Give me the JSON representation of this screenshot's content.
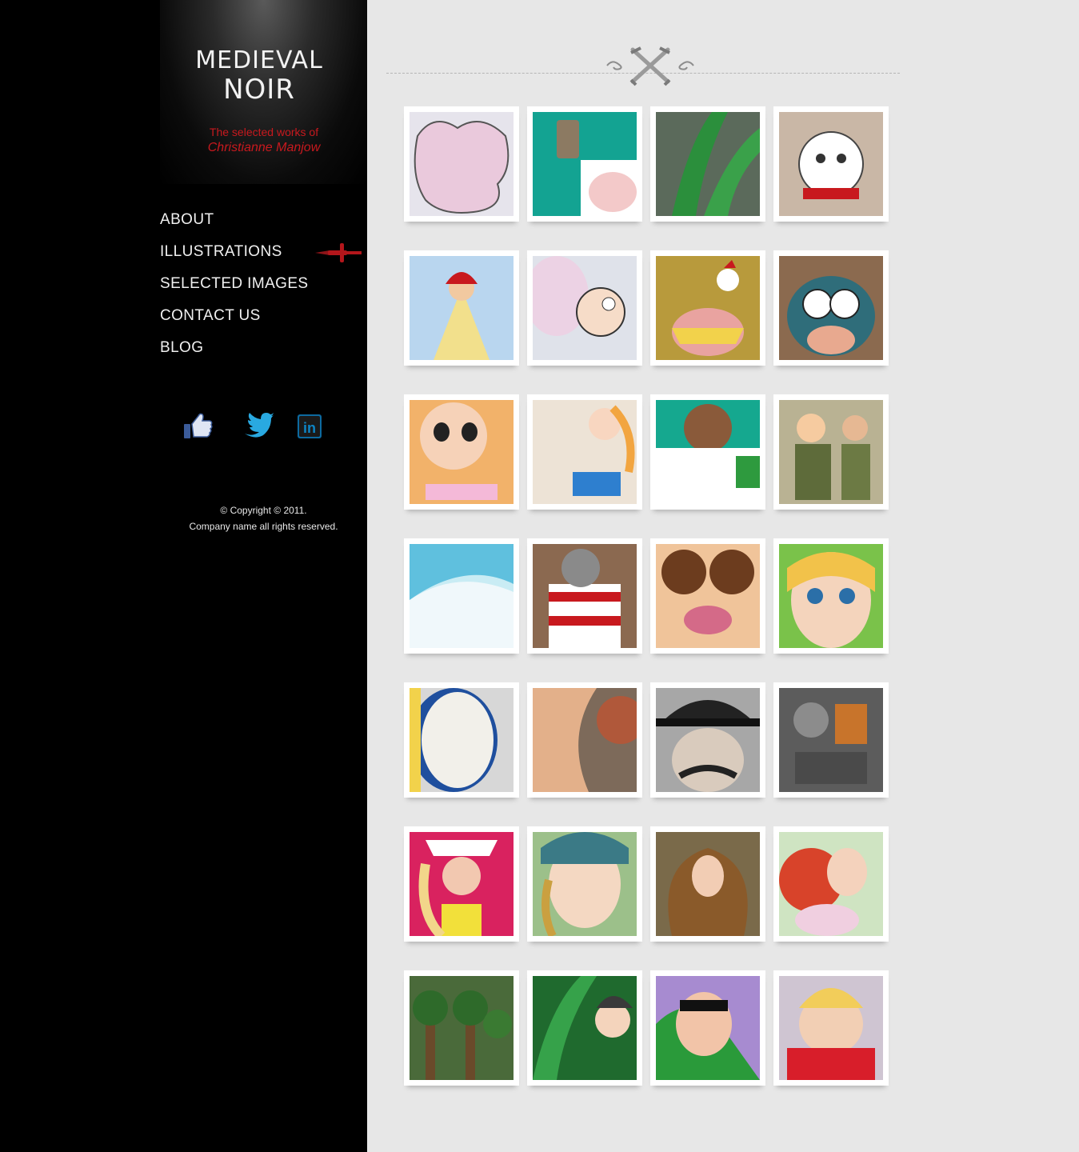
{
  "brand": {
    "line1": "MEDIEVAL",
    "line2": "NOIR"
  },
  "tagline": {
    "line1": "The selected works of",
    "line2": "Christianne Manjow"
  },
  "nav": [
    {
      "label": "ABOUT",
      "active": false
    },
    {
      "label": "ILLUSTRATIONS",
      "active": true
    },
    {
      "label": "SELECTED IMAGES",
      "active": false
    },
    {
      "label": "CONTACT US",
      "active": false
    },
    {
      "label": "BLOG",
      "active": false
    }
  ],
  "social": [
    {
      "name": "facebook-like-icon"
    },
    {
      "name": "twitter-icon"
    },
    {
      "name": "linkedin-icon",
      "text": "in"
    }
  ],
  "copyright": {
    "line1": "© Copyright © 2011.",
    "line2": "Company name all rights reserved."
  },
  "colors": {
    "accent_red": "#c8191e",
    "sidebar": "#000000",
    "main_bg": "#e7e7e7"
  },
  "gallery": {
    "thumbnails": [
      "brain",
      "bottle-and-cow",
      "green-leaves",
      "angry-dog",
      "red-riding-fairy",
      "kissing-kid",
      "chicken",
      "scared-fish",
      "blonde-girl",
      "pinup-girl",
      "cow-milk",
      "scouts",
      "wave",
      "bear-in-bucket",
      "hungry-face",
      "blonde-face",
      "drum",
      "kissing-profile",
      "mustache-man",
      "robot-collage",
      "diva-hat",
      "curly-woman",
      "long-haired-girl",
      "red-haired-girl",
      "tree-people",
      "leaves-monster",
      "superhero",
      "plump-lady"
    ]
  }
}
